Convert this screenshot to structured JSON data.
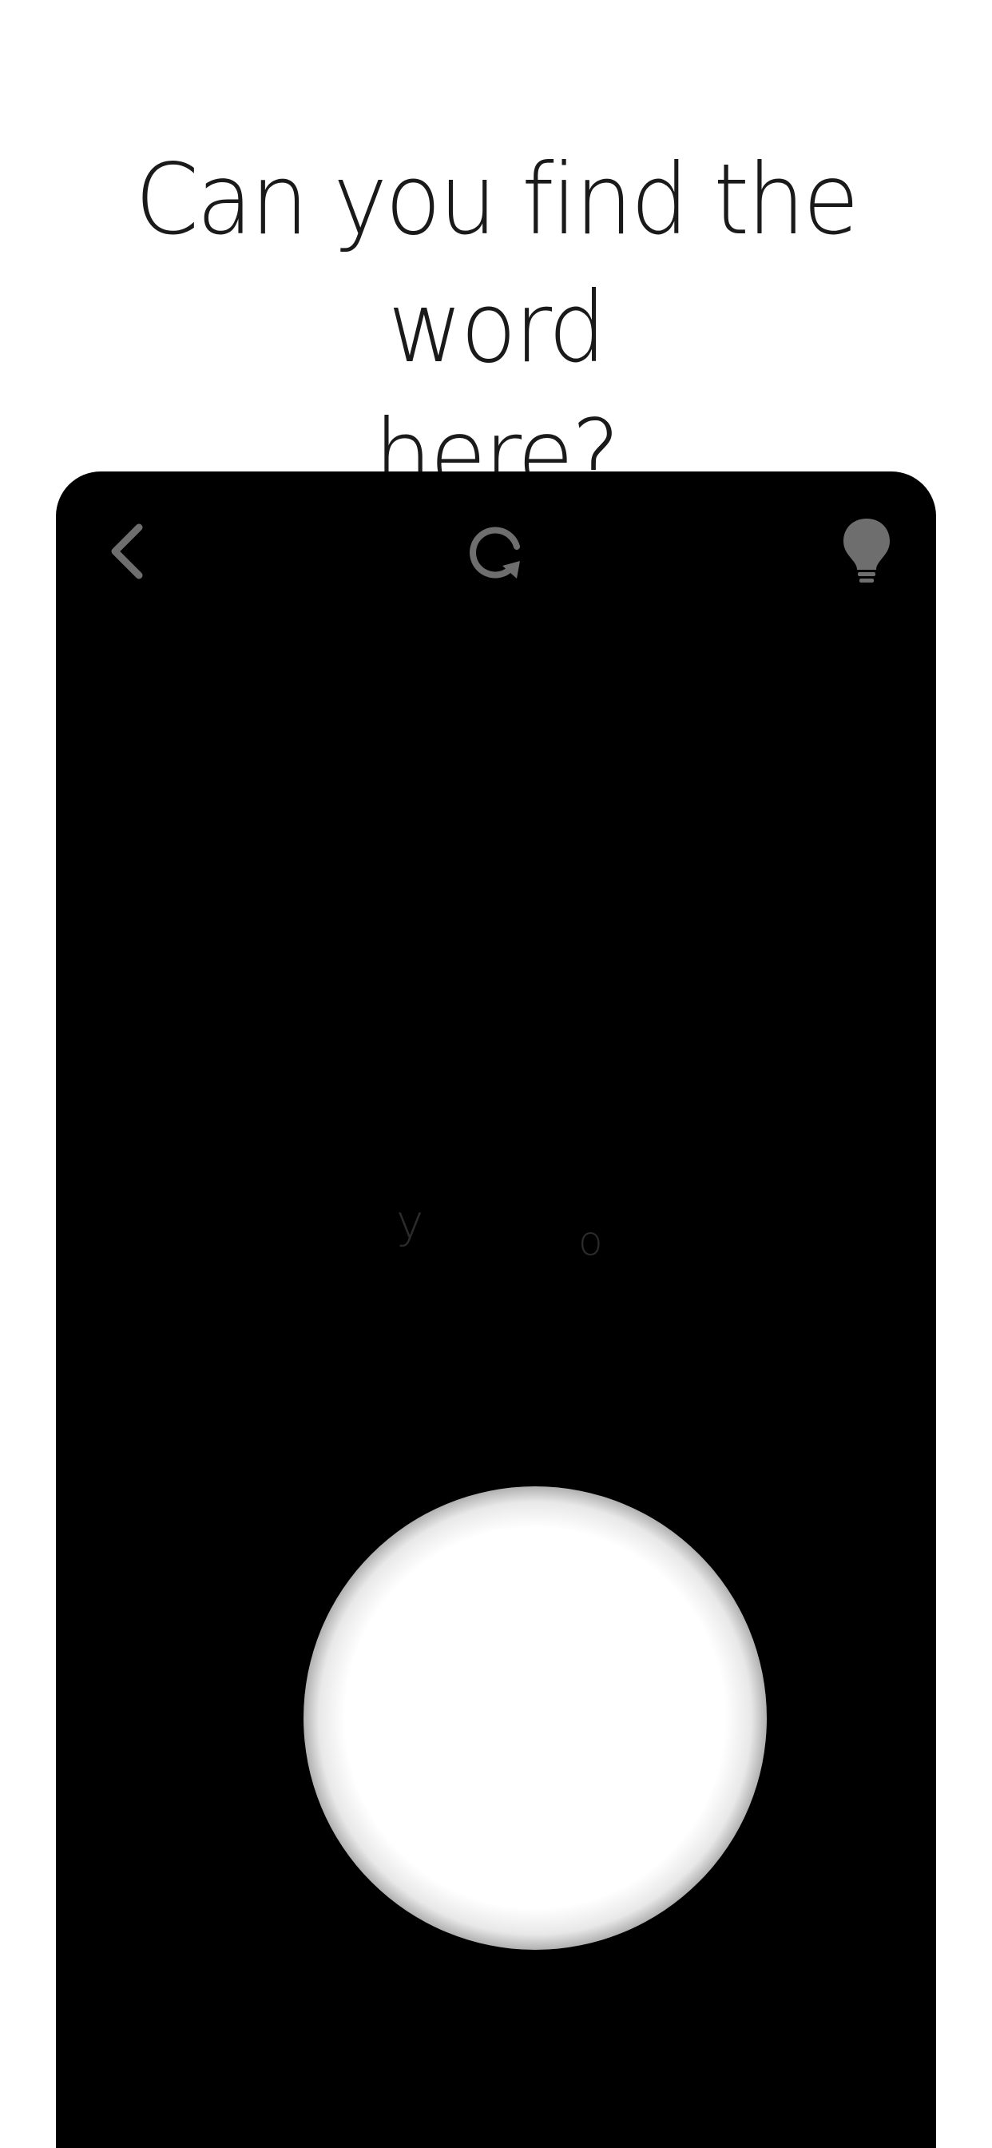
{
  "headline": {
    "line1": "Can you find the word",
    "line2": "here?"
  },
  "toolbar": {
    "back_icon": "chevron-left-icon",
    "restart_icon": "restart-icon",
    "hint_icon": "lightbulb-icon",
    "icon_color": "#6e6e6e"
  },
  "board": {
    "background": "#000000",
    "spotlight_color": "#ffffff",
    "letters": [
      "y",
      "o"
    ]
  }
}
